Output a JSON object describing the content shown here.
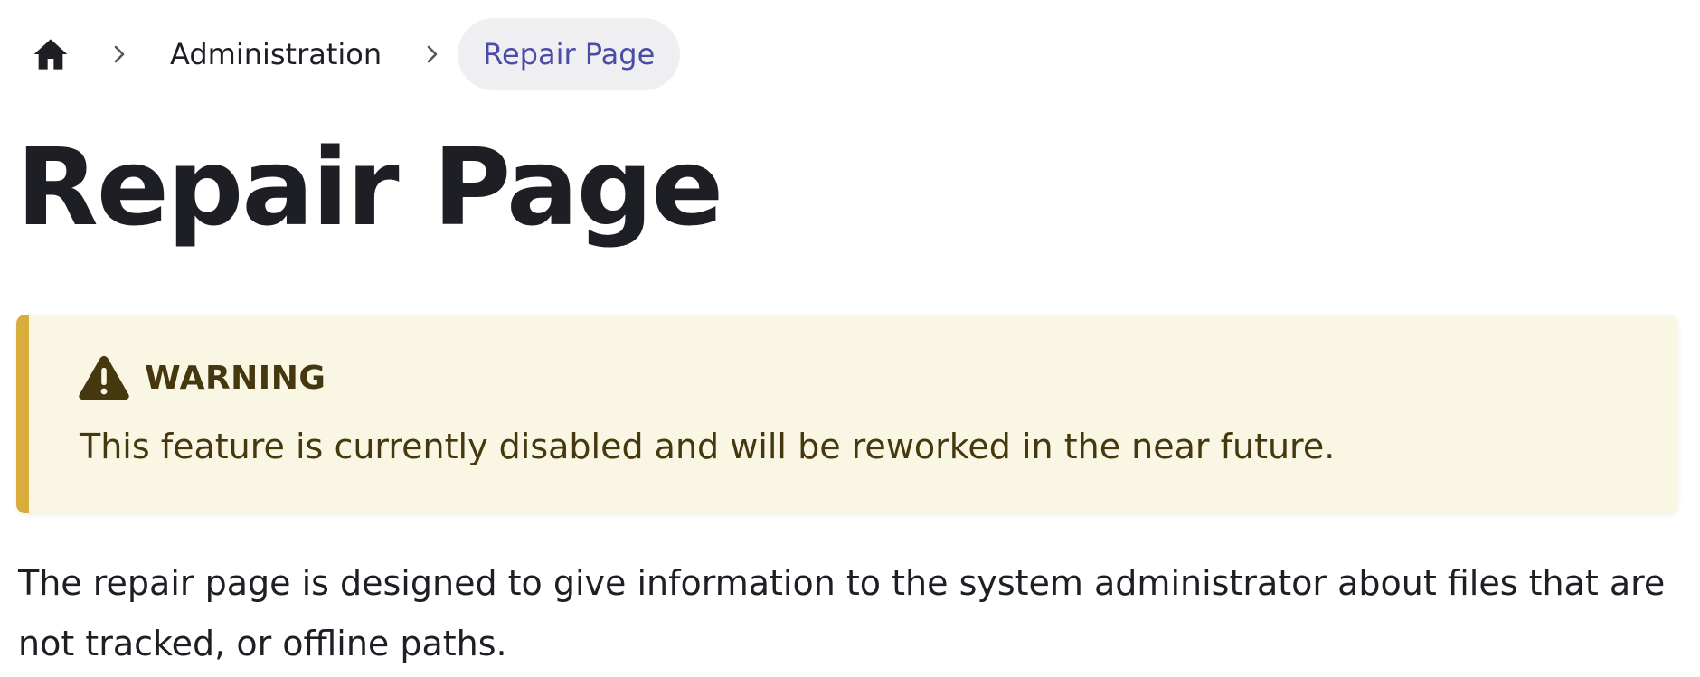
{
  "breadcrumb": {
    "home_icon": "home-icon",
    "separator_icon": "chevron-right-icon",
    "items": [
      {
        "label": "Administration"
      },
      {
        "label": "Repair Page"
      }
    ]
  },
  "page": {
    "title": "Repair Page",
    "description": "The repair page is designed to give information to the system administrator about files that are not tracked, or offline paths."
  },
  "warning": {
    "icon": "warning-triangle-icon",
    "title": "WARNING",
    "message": "This feature is currently disabled and will be reworked in the near future."
  },
  "colors": {
    "accent": "#4b4ba8",
    "warning_border": "#d8ad3d",
    "warning_bg": "#faf6e4",
    "warning_text": "#45380f",
    "breadcrumb_active_bg": "#efeff1"
  }
}
